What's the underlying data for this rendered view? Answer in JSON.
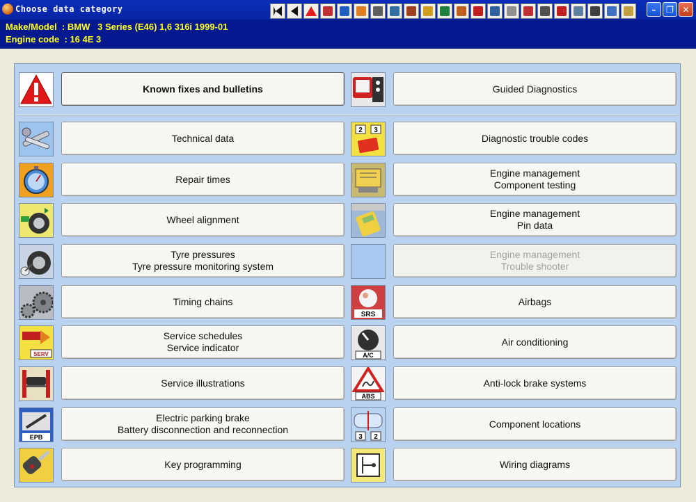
{
  "window": {
    "title": "Choose data category"
  },
  "vehicle": {
    "make_model_line": "Make/Model  : BMW   3 Series (E46) 1,6 316i 1999-01",
    "engine_line": "Engine code  : 16 4E 3"
  },
  "toolbar_icons": [
    "first-page-icon",
    "back-icon",
    "warning-icon",
    "tech-data-icon",
    "wrench-icon",
    "repair-times-icon",
    "wheel-icon",
    "tyre-icon",
    "timing-icon",
    "service-icon",
    "lift-icon",
    "ecu-icon",
    "engine-icon",
    "pin-data-icon",
    "trouble-icon",
    "srs-icon",
    "ac-icon",
    "abs-icon",
    "components-icon",
    "wiring-icon",
    "car-icon",
    "info-icon"
  ],
  "left": [
    {
      "label": "Known fixes and bulletins",
      "icon": "warning-icon",
      "bold": true
    },
    {
      "label": "Technical data",
      "icon": "tools-icon"
    },
    {
      "label": "Repair times",
      "icon": "stopwatch-icon"
    },
    {
      "label": "Wheel alignment",
      "icon": "wheel-alignment-icon"
    },
    {
      "label": "Tyre pressures\nTyre pressure monitoring system",
      "icon": "tyre-gauge-icon"
    },
    {
      "label": "Timing chains",
      "icon": "timing-chain-icon"
    },
    {
      "label": "Service schedules\nService indicator",
      "icon": "service-indicator-icon"
    },
    {
      "label": "Service illustrations",
      "icon": "car-lift-icon"
    },
    {
      "label": "Electric parking brake\nBattery disconnection and reconnection",
      "icon": "epb-icon"
    },
    {
      "label": "Key programming",
      "icon": "car-key-icon"
    }
  ],
  "right": [
    {
      "label": "Guided Diagnostics",
      "icon": "diagnostic-tool-icon"
    },
    {
      "label": "Diagnostic trouble codes",
      "icon": "trouble-codes-icon"
    },
    {
      "label": "Engine management\nComponent testing",
      "icon": "ecu-icon"
    },
    {
      "label": "Engine management\nPin data",
      "icon": "multimeter-icon"
    },
    {
      "label": "Engine management\nTrouble shooter",
      "icon": "blank-icon",
      "disabled": true
    },
    {
      "label": "Airbags",
      "icon": "srs-icon"
    },
    {
      "label": "Air conditioning",
      "icon": "ac-knob-icon"
    },
    {
      "label": "Anti-lock brake systems",
      "icon": "abs-icon"
    },
    {
      "label": "Component locations",
      "icon": "component-location-icon"
    },
    {
      "label": "Wiring diagrams",
      "icon": "wiring-diagram-icon"
    }
  ],
  "icon_texts": {
    "srs": "SRS",
    "ac": "A/C",
    "abs": "ABS",
    "epb": "EPB",
    "serv": "SERV",
    "codes": "2 3",
    "locations": "3 2"
  }
}
